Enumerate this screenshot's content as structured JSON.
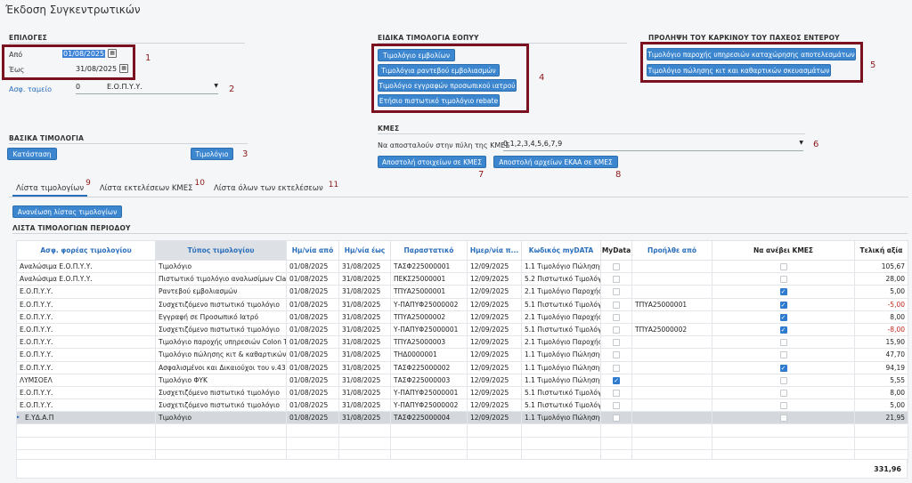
{
  "title": "Έκδοση Συγκεντρωτικών",
  "options": {
    "heading": "ΕΠΙΛΟΓΕΣ",
    "from_label": "Από",
    "from_value": "01/08/2025",
    "to_label": "Έως",
    "to_value": "31/08/2025",
    "fund_label": "Ασφ. ταμείο",
    "fund_code": "0",
    "fund_name": "Ε.Ο.Π.Υ.Υ."
  },
  "eopyy": {
    "heading": "ΕΙΔΙΚΑ ΤΙΜΟΛΟΓΙΑ ΕΟΠΥΥ",
    "buttons": [
      "Τιμολόγιο εμβολίων",
      "Τιμολόγια ραντεβού εμβολιασμών",
      "Τιμολόγιο εγγραφών προσωπικού ιατρού",
      "Ετήσιο πιστωτικό τιμολόγιο rebate"
    ]
  },
  "cancer": {
    "heading": "ΠΡΟΛΗΨΗ ΤΟΥ ΚΑΡΚΙΝΟΥ ΤΟΥ ΠΑΧΕΟΣ ΕΝΤΕΡΟΥ",
    "buttons": [
      "Τιμολόγιο παροχής υπηρεσιών καταχώρησης αποτελεσμάτων",
      "Τιμολόγιο πώλησης κιτ και καθαρτικών σκευασμάτων"
    ]
  },
  "basic": {
    "heading": "ΒΑΣΙΚΑ ΤΙΜΟΛΟΓΙΑ",
    "status_button": "Κατάσταση",
    "invoice_button": "Τιμολόγιο"
  },
  "kmes": {
    "heading": "ΚΜΕΣ",
    "send_label": "Να αποσταλούν στην πύλη της ΚΜΕΣ",
    "send_value": "0,1,2,3,4,5,6,7,9",
    "send_data_button": "Αποστολή στοιχείων σε ΚΜΕΣ",
    "send_files_button": "Αποστολή αρχείων ΕΚΑΑ σε ΚΜΕΣ"
  },
  "markers": [
    "1",
    "2",
    "3",
    "4",
    "5",
    "6",
    "7",
    "8",
    "9",
    "10",
    "11"
  ],
  "tabs": [
    "Λίστα τιμολογίων",
    "Λίστα εκτελέσεων ΚΜΕΣ",
    "Λίστα όλων των εκτελέσεων"
  ],
  "refresh_button": "Ανανέωση λίστας τιμολογίων",
  "list_heading": "ΛΙΣΤΑ ΤΙΜΟΛΟΓΙΩΝ ΠΕΡΙΟΔΟΥ",
  "table": {
    "columns": [
      "Ασφ. φορέας τιμολογίου",
      "Τύπος τιμολογίου",
      "Ημ/νία από",
      "Ημ/νία έως",
      "Παραστατικό",
      "Ημερ/νία π...",
      "Κωδικός myDATA",
      "MyData",
      "Προήλθε από",
      "Να ανέβει ΚΜΕΣ",
      "Τελική αξία"
    ],
    "rows": [
      [
        "Αναλώσιμα Ε.Ο.Π.Υ.Υ.",
        "Τιμολόγιο",
        "01/08/2025",
        "31/08/2025",
        "ΤΑΣΦ225000001",
        "12/09/2025",
        "1.1 Τιμολόγιο Πώλησης",
        false,
        "",
        false,
        "105,67"
      ],
      [
        "Αναλώσιμα Ε.Ο.Π.Υ.Υ.",
        "Πιστωτικό τιμολόγιο αναλωσίμων Clawb",
        "01/08/2025",
        "31/08/2025",
        "ΠΕΚΣ25000001",
        "12/09/2025",
        "5.2 Πιστωτικό Τιμολόγ",
        false,
        "",
        false,
        "28,00"
      ],
      [
        "Ε.Ο.Π.Υ.Υ.",
        "Ραντεβού εμβολιασμών",
        "01/08/2025",
        "31/08/2025",
        "ΤΠΥΑ25000001",
        "12/09/2025",
        "2.1 Τιμολόγιο Παροχής",
        false,
        "",
        true,
        "5,00"
      ],
      [
        "Ε.Ο.Π.Υ.Υ.",
        "Συσχετιζόμενο πιστωτικό τιμολόγιο",
        "01/08/2025",
        "31/08/2025",
        "Υ-ΠΑΠΥΦ25000002",
        "12/09/2025",
        "5.1 Πιστωτικό Τιμολόγ",
        false,
        "ΤΠΥΑ25000001",
        true,
        "-5,00"
      ],
      [
        "Ε.Ο.Π.Υ.Υ.",
        "Εγγραφή σε Προσωπικό Ιατρό",
        "01/08/2025",
        "31/08/2025",
        "ΤΠΥΑ25000002",
        "12/09/2025",
        "2.1 Τιμολόγιο Παροχής",
        false,
        "",
        true,
        "8,00"
      ],
      [
        "Ε.Ο.Π.Υ.Υ.",
        "Συσχετιζόμενο πιστωτικό τιμολόγιο",
        "01/08/2025",
        "31/08/2025",
        "Υ-ΠΑΠΥΦ25000001",
        "12/09/2025",
        "5.1 Πιστωτικό Τιμολόγ",
        false,
        "ΤΠΥΑ25000002",
        true,
        "-8,00"
      ],
      [
        "Ε.Ο.Π.Υ.Υ.",
        "Τιμολόγιο παροχής υπηρεσιών Colon Te",
        "01/08/2025",
        "31/08/2025",
        "ΤΠΥΑ25000003",
        "12/09/2025",
        "2.1 Τιμολόγιο Παροχής",
        false,
        "",
        false,
        "15,90"
      ],
      [
        "Ε.Ο.Π.Υ.Υ.",
        "Τιμολόγιο πώλησης κιτ & καθαρτικών Co",
        "01/08/2025",
        "31/08/2025",
        "ΤΗΔ0000001",
        "12/09/2025",
        "1.1 Τιμολόγιο Πώλησης",
        false,
        "",
        false,
        "47,70"
      ],
      [
        "Ε.Ο.Π.Υ.Υ.",
        "Ασφαλισμένοι και Δικαιούχοι του ν.4368",
        "01/08/2025",
        "31/08/2025",
        "ΤΑΣΦ225000002",
        "12/09/2025",
        "1.1 Τιμολόγιο Πώλησης",
        false,
        "",
        true,
        "94,19"
      ],
      [
        "ΛΥΜΣΟΕΛ",
        "Τιμολόγιο ΦΥΚ",
        "01/08/2025",
        "31/08/2025",
        "ΤΑΣΦ225000003",
        "12/09/2025",
        "1.1 Τιμολόγιο Πώλησης",
        true,
        "",
        false,
        "5,55"
      ],
      [
        "Ε.Ο.Π.Υ.Υ.",
        "Συσχετιζόμενο πιστωτικό τιμολόγιο",
        "01/08/2025",
        "31/08/2025",
        "Υ-ΠΑΠΥΦ25000001",
        "12/09/2025",
        "5.1 Πιστωτικό Τιμολόγ",
        false,
        "",
        false,
        "8,00"
      ],
      [
        "Ε.Ο.Π.Υ.Υ.",
        "Συσχετιζόμενο πιστωτικό τιμολόγιο",
        "01/08/2025",
        "31/08/2025",
        "Υ-ΠΑΠΥΦ25000002",
        "12/09/2025",
        "5.1 Πιστωτικό Τιμολόγ",
        false,
        "",
        false,
        "5,00"
      ],
      [
        "Ε.ΥΔ.Α.Π",
        "Τιμολόγιο",
        "01/08/2025",
        "31/08/2025",
        "ΤΑΣΦ225000004",
        "12/09/2025",
        "1.1 Τιμολόγιο Πώλησης",
        false,
        "",
        false,
        "21,95"
      ]
    ],
    "total": "331,96"
  }
}
